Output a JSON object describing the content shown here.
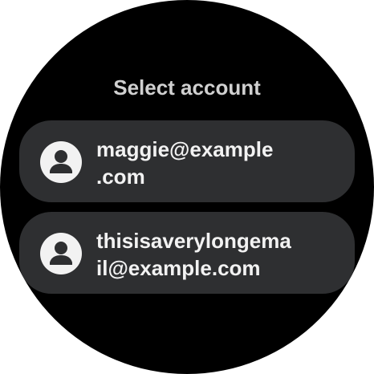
{
  "header": {
    "title": "Select account"
  },
  "accounts": [
    {
      "line1": "maggie@example",
      "line2": ".com",
      "icon": "account-circle-icon"
    },
    {
      "line1": "thisisaverylongema",
      "line2": "il@example.com",
      "icon": "account-circle-icon"
    }
  ],
  "colors": {
    "background": "#000000",
    "chip": "#2e2f31",
    "text": "#f2f2f2",
    "title": "#d0d0d0"
  }
}
